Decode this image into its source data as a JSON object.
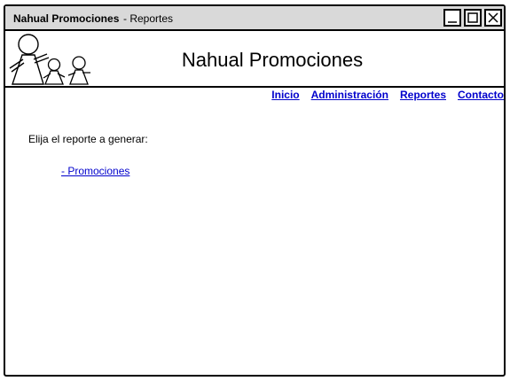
{
  "window": {
    "app_title": "Nahual Promociones",
    "page_title": "- Reportes",
    "controls": [
      "minimize-icon",
      "maximize-icon",
      "close-icon"
    ]
  },
  "header": {
    "logo_icon": "people-family-icon",
    "title": "Nahual Promociones"
  },
  "nav": {
    "items": [
      {
        "label": "Inicio"
      },
      {
        "label": "Administración"
      },
      {
        "label": "Reportes"
      },
      {
        "label": "Contacto"
      }
    ]
  },
  "main": {
    "prompt": "Elija el reporte a generar:",
    "reports": [
      {
        "label": "- Promociones"
      }
    ]
  },
  "colors": {
    "titlebar": "#d9d9d9",
    "link": "#0000cc",
    "border": "#000000"
  }
}
